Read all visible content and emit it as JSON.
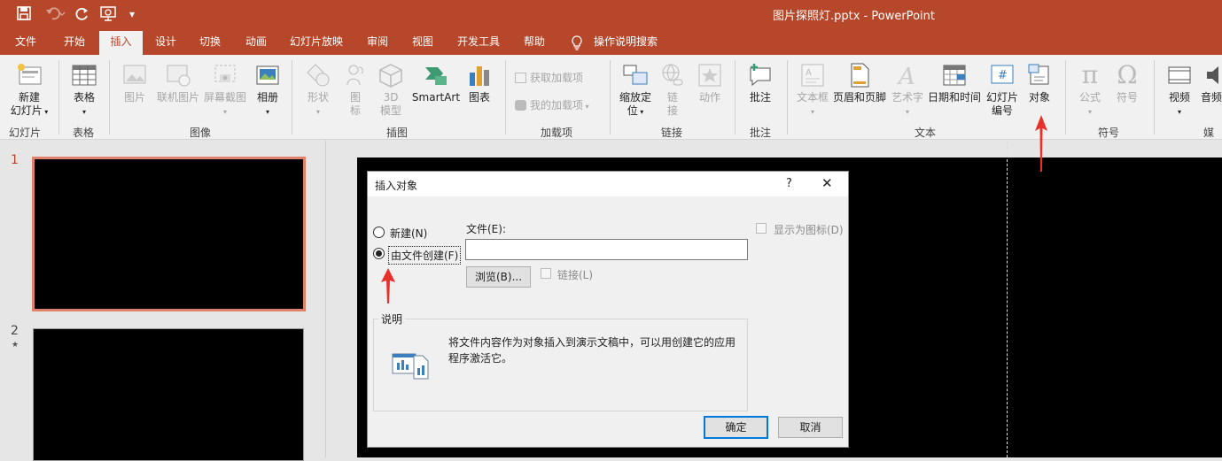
{
  "titlebar": {
    "title": "图片探照灯.pptx  -  PowerPoint",
    "qa_save": "save-icon",
    "qa_undo": "undo-icon",
    "qa_redo": "redo-icon",
    "qa_present": "present-icon",
    "qa_more": "customize-icon"
  },
  "menu": {
    "tabs": [
      "文件",
      "开始",
      "插入",
      "设计",
      "切换",
      "动画",
      "幻灯片放映",
      "审阅",
      "视图",
      "开发工具",
      "帮助"
    ],
    "active_tab": "插入",
    "tell_me": "操作说明搜索"
  },
  "ribbon": {
    "new_slide": "新建\n幻灯片",
    "table": "表格",
    "picture": "图片",
    "online_picture": "联机图片",
    "screenshot": "屏幕截图",
    "album": "相册",
    "shapes": "形状",
    "icons": "图\n标",
    "model3d": "3D\n模型",
    "smartart": "SmartArt",
    "chart": "图表",
    "get_addins": "获取加载项",
    "my_addins": "我的加载项",
    "zoom": "缩放定\n位",
    "link": "链\n接",
    "action": "动作",
    "comment": "批注",
    "textbox": "文本框",
    "header_footer": "页眉和页脚",
    "wordart": "艺术字",
    "datetime": "日期和时间",
    "slide_number": "幻灯片\n编号",
    "object": "对象",
    "equation": "公式",
    "symbol": "符号",
    "video": "视频",
    "audio": "音频",
    "groups": {
      "slides": "幻灯片",
      "tables": "表格",
      "images": "图像",
      "illustrations": "插图",
      "addins": "加载项",
      "links": "链接",
      "comments": "批注",
      "text": "文本",
      "symbols": "符号",
      "media": "媒体"
    }
  },
  "slides": [
    {
      "num": "1"
    },
    {
      "num": "2",
      "star": "★"
    }
  ],
  "dialog": {
    "title": "插入对象",
    "help": "?",
    "close": "✕",
    "opt_new": "新建(N)",
    "opt_from_file": "由文件创建(F)",
    "file_label": "文件(E):",
    "file_value": "",
    "browse": "浏览(B)...",
    "link": "链接(L)",
    "show_icon": "显示为图标(D)",
    "desc_title": "说明",
    "desc_text": "将文件内容作为对象插入到演示文稿中，可以用创建它的应用程序激活它。",
    "ok": "确定",
    "cancel": "取消"
  },
  "colors": {
    "brand": "#b7472a",
    "accent_arrow": "#e8312a"
  }
}
